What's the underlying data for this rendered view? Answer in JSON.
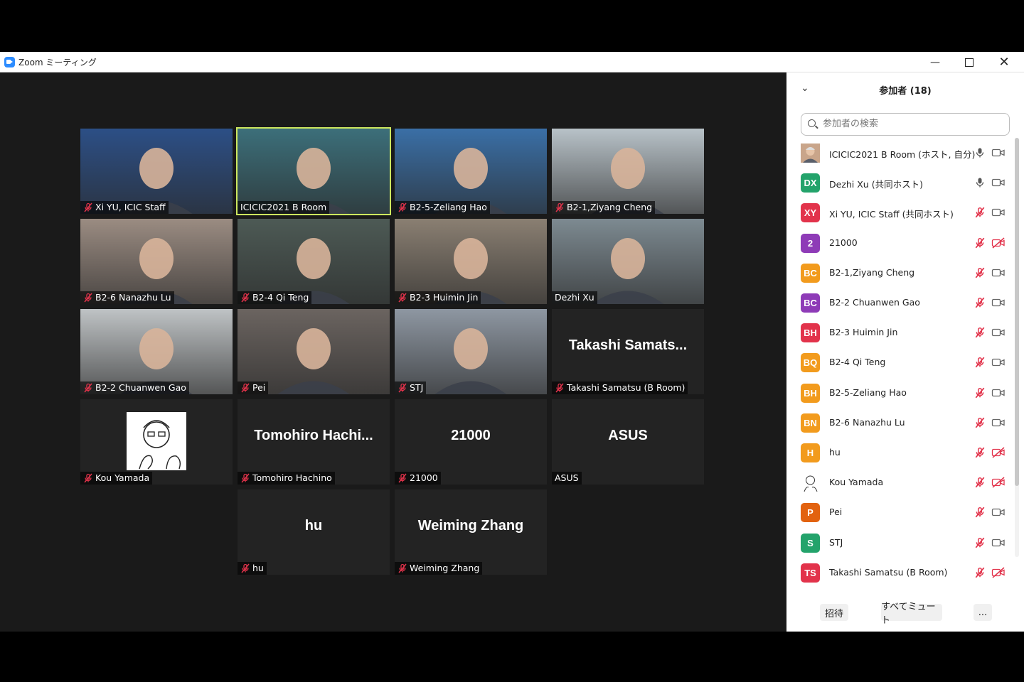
{
  "window": {
    "title": "Zoom ミーティング"
  },
  "tiles": [
    {
      "name": "Xi YU, ICIC Staff",
      "muted": true,
      "kind": "photo",
      "bg": "#2c4f86"
    },
    {
      "name": "ICICIC2021 B Room",
      "muted": false,
      "kind": "photo",
      "bg": "#3c6f7a",
      "active": true
    },
    {
      "name": "B2-5-Zeliang Hao",
      "muted": true,
      "kind": "photo",
      "bg": "#3a6fa6"
    },
    {
      "name": "B2-1,Ziyang Cheng",
      "muted": true,
      "kind": "photo",
      "bg": "#b8c2c8"
    },
    {
      "name": "B2-6 Nanazhu Lu",
      "muted": true,
      "kind": "photo",
      "bg": "#9b8c82"
    },
    {
      "name": "B2-4 Qi Teng",
      "muted": true,
      "kind": "photo",
      "bg": "#4d5a55"
    },
    {
      "name": "B2-3 Huimin Jin",
      "muted": true,
      "kind": "photo",
      "bg": "#8a7f72"
    },
    {
      "name": "Dezhi Xu",
      "muted": false,
      "kind": "photo",
      "bg": "#7d8a91"
    },
    {
      "name": "B2-2 Chuanwen Gao",
      "muted": true,
      "kind": "photo",
      "bg": "#bfc3c5"
    },
    {
      "name": "Pei",
      "muted": true,
      "kind": "photo",
      "bg": "#6b6460"
    },
    {
      "name": "STJ",
      "muted": true,
      "kind": "photo",
      "bg": "#8e97a2"
    },
    {
      "name": "Takashi Samatsu (B Room)",
      "muted": true,
      "kind": "text",
      "big": "Takashi  Samats..."
    },
    {
      "name": "Kou Yamada",
      "muted": true,
      "kind": "avatar"
    },
    {
      "name": "Tomohiro Hachino",
      "muted": true,
      "kind": "text",
      "big": "Tomohiro  Hachi..."
    },
    {
      "name": "21000",
      "muted": true,
      "kind": "text",
      "big": "21000"
    },
    {
      "name": "ASUS",
      "muted": false,
      "kind": "text",
      "big": "ASUS"
    },
    {
      "name": "hu",
      "muted": true,
      "kind": "text",
      "big": "hu"
    },
    {
      "name": "Weiming Zhang",
      "muted": true,
      "kind": "text",
      "big": "Weiming Zhang"
    }
  ],
  "panel": {
    "title": "参加者 (18)",
    "search_placeholder": "参加者の検索",
    "participants": [
      {
        "name": "ICICIC2021 B Room (ホスト, 自分)",
        "initials": "",
        "color": "#b07a5a",
        "photo": true,
        "mic": "on",
        "cam": "on"
      },
      {
        "name": "Dezhi Xu (共同ホスト)",
        "initials": "DX",
        "color": "#23a36b",
        "mic": "on",
        "cam": "on"
      },
      {
        "name": "Xi YU, ICIC Staff (共同ホスト)",
        "initials": "XY",
        "color": "#e2334b",
        "mic": "off",
        "cam": "on"
      },
      {
        "name": "21000",
        "initials": "2",
        "color": "#8e3bb7",
        "mic": "off",
        "cam": "off"
      },
      {
        "name": "B2-1,Ziyang Cheng",
        "initials": "BC",
        "color": "#f29b1d",
        "mic": "off",
        "cam": "on"
      },
      {
        "name": "B2-2 Chuanwen Gao",
        "initials": "BC",
        "color": "#8e3bb7",
        "mic": "off",
        "cam": "on"
      },
      {
        "name": "B2-3 Huimin Jin",
        "initials": "BH",
        "color": "#e2334b",
        "mic": "off",
        "cam": "on"
      },
      {
        "name": "B2-4 Qi Teng",
        "initials": "BQ",
        "color": "#f29b1d",
        "mic": "off",
        "cam": "on"
      },
      {
        "name": "B2-5-Zeliang Hao",
        "initials": "BH",
        "color": "#f29b1d",
        "mic": "off",
        "cam": "on"
      },
      {
        "name": "B2-6 Nanazhu Lu",
        "initials": "BN",
        "color": "#f29b1d",
        "mic": "off",
        "cam": "on"
      },
      {
        "name": "hu",
        "initials": "H",
        "color": "#f29b1d",
        "mic": "off",
        "cam": "off"
      },
      {
        "name": "Kou Yamada",
        "initials": "",
        "color": "#ffffff",
        "avatar": true,
        "mic": "off",
        "cam": "off"
      },
      {
        "name": "Pei",
        "initials": "P",
        "color": "#e2620f",
        "mic": "off",
        "cam": "on"
      },
      {
        "name": "STJ",
        "initials": "S",
        "color": "#23a36b",
        "mic": "off",
        "cam": "on"
      },
      {
        "name": "Takashi Samatsu (B Room)",
        "initials": "TS",
        "color": "#e2334b",
        "mic": "off",
        "cam": "off"
      }
    ],
    "invite_label": "招待",
    "mute_all_label": "すべてミュート",
    "more_label": "..."
  },
  "colors": {
    "muted_red": "#e2334b",
    "active_speaker": "#cde75e"
  }
}
